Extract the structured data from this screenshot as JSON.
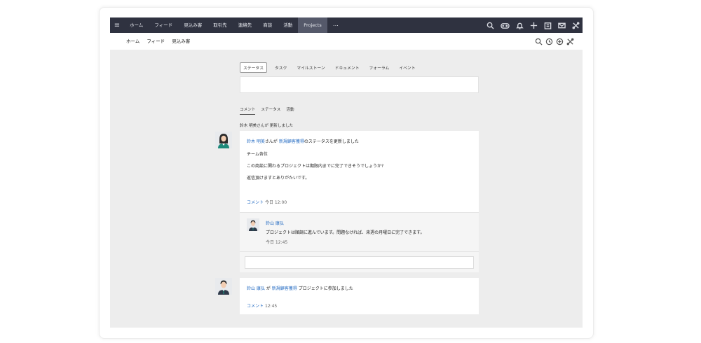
{
  "topbar": {
    "nav": [
      "ホーム",
      "フィード",
      "見込み客",
      "取引先",
      "連絡先",
      "商談",
      "活動",
      "Projects"
    ],
    "active_index": 7,
    "more": "⋯"
  },
  "subbar": {
    "tabs": [
      "ホーム",
      "フィード",
      "見込み客"
    ],
    "active_index": 1
  },
  "compose": {
    "tabs": [
      "ステータス",
      "タスク",
      "マイルストーン",
      "ドキュメント",
      "フォーラム",
      "イベント"
    ]
  },
  "filters": [
    "コメント",
    "ステータス",
    "活動"
  ],
  "activity_label": "鈴木 明美さんが 更新しました",
  "post1": {
    "author": "鈴木 明美",
    "mid": "さんが",
    "project": "新規顧客獲得",
    "suffix": "のステータスを更新しました",
    "line1": "チーム各位",
    "line2": "この商談に関わるプロジェクトは期限内までに完了できそうでしょうか?",
    "line3": "返信頂けますとありがたいです。",
    "comment_label": "コメント",
    "time": "今日 12:00"
  },
  "reply1": {
    "author": "鈴山 康弘",
    "text": "プロジェクトは順調に進んでいます。問題なければ、来週の月曜日に完了できます。",
    "time": "今日 12:45"
  },
  "post2": {
    "author": "鈴山 康弘",
    "mid": "が",
    "project": "新規顧客獲得",
    "suffix": "プロジェクトに参加しました",
    "comment_label": "コメント",
    "time": "12:45"
  },
  "colors": {
    "topbar": "#2f3240",
    "link": "#2a6fc4",
    "background": "#ededed"
  }
}
